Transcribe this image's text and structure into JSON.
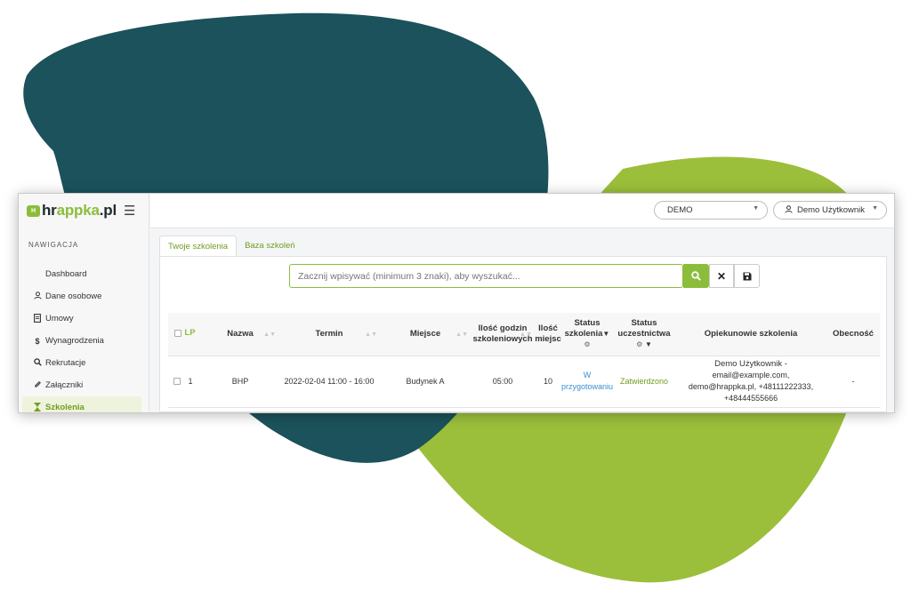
{
  "brand": {
    "logo_mark": "H",
    "name_main": "hr",
    "name_accent": "appka",
    "name_suffix": ".pl",
    "accent_color": "#8bbd3b"
  },
  "sidebar": {
    "section_title": "NAWIGACJA",
    "items": [
      {
        "label": "Dashboard",
        "icon": "none"
      },
      {
        "label": "Dane osobowe",
        "icon": "user-icon"
      },
      {
        "label": "Umowy",
        "icon": "document-icon"
      },
      {
        "label": "Wynagrodzenia",
        "icon": "dollar-icon"
      },
      {
        "label": "Rekrutacje",
        "icon": "search-icon"
      },
      {
        "label": "Załączniki",
        "icon": "paperclip-icon"
      },
      {
        "label": "Szkolenia",
        "icon": "hourglass-icon",
        "active": true
      }
    ]
  },
  "topbar": {
    "company_select": "DEMO",
    "user_name": "Demo Użytkownik"
  },
  "tabs": [
    {
      "label": "Twoje szkolenia",
      "active": true
    },
    {
      "label": "Baza szkoleń",
      "active": false
    }
  ],
  "search": {
    "placeholder": "Zacznij wpisywać (minimum 3 znaki), aby wyszukać..."
  },
  "table": {
    "headers": {
      "lp": "LP",
      "name": "Nazwa",
      "term": "Termin",
      "place": "Miejsce",
      "hours_1": "Ilość godzin",
      "hours_2": "szkoleniowych",
      "seats_1": "Ilość",
      "seats_2": "miejsc",
      "status_1": "Status",
      "status_2": "szkolenia",
      "participation_1": "Status",
      "participation_2": "uczestnictwa",
      "supervisors": "Opiekunowie szkolenia",
      "attendance": "Obecność"
    },
    "rows": [
      {
        "lp": "1",
        "name": "BHP",
        "term": "2022-02-04 11:00 - 16:00",
        "place": "Budynek A",
        "hours": "05:00",
        "seats": "10",
        "status_1": "W",
        "status_2": "przygotowaniu",
        "participation": "Zatwierdzono",
        "supervisor_name": "Demo Użytkownik -",
        "supervisor_line_1": "email@example.com,",
        "supervisor_line_2": "demo@hrappka.pl, +48111222333,",
        "supervisor_line_3": "+48444555666",
        "attendance": "-"
      }
    ]
  }
}
